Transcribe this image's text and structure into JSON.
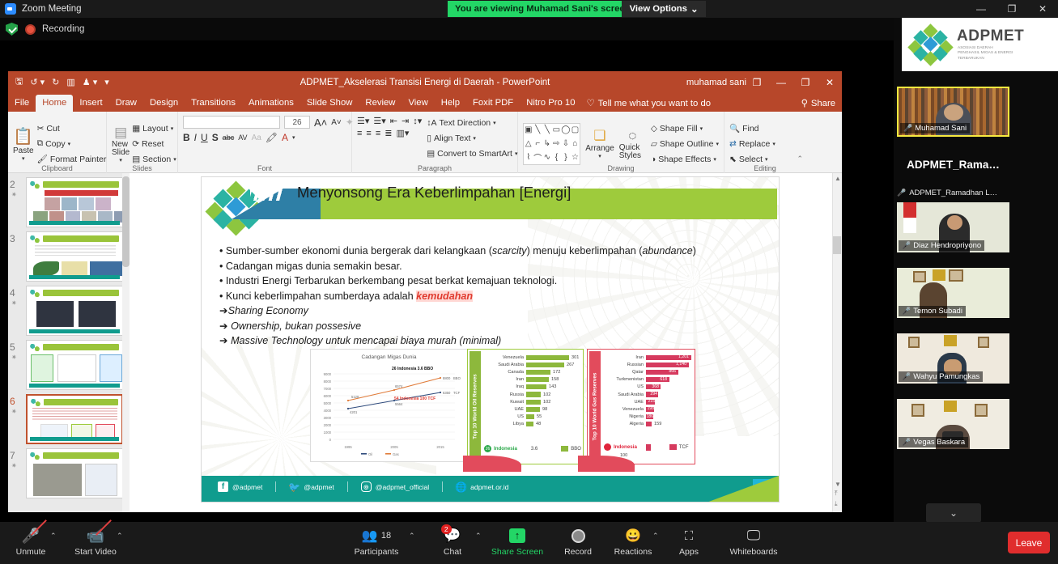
{
  "zoom": {
    "window_title": "Zoom Meeting",
    "viewing_banner": "You are viewing Muhamad Sani's screen",
    "view_options": "View Options",
    "view_options_caret": "⌄",
    "recording_label": "Recording",
    "win_min": "—",
    "win_max": "❐",
    "win_close": "✕"
  },
  "powerpoint": {
    "document_title": "ADPMET_Akselerasi Transisi Energi di Daerah",
    "app_name": "PowerPoint",
    "title_separator": "-",
    "user": "muhamad sani",
    "qat": [
      "save-icon",
      "undo-icon",
      "redo-icon",
      "present-icon",
      "account-icon",
      "more-icon"
    ],
    "win_restore": "❐",
    "win_min": "—",
    "win_max": "❐",
    "win_close": "✕",
    "tabs": [
      "File",
      "Home",
      "Insert",
      "Draw",
      "Design",
      "Transitions",
      "Animations",
      "Slide Show",
      "Review",
      "View",
      "Help",
      "Foxit PDF",
      "Nitro Pro 10"
    ],
    "active_tab": "Home",
    "tell_me": "Tell me what you want to do",
    "share": "Share",
    "groups": {
      "clipboard": {
        "label": "Clipboard",
        "paste": "Paste",
        "cut": "Cut",
        "copy": "Copy",
        "format_painter": "Format Painter"
      },
      "slides": {
        "label": "Slides",
        "new_slide": "New Slide",
        "layout": "Layout",
        "reset": "Reset",
        "section": "Section"
      },
      "font": {
        "label": "Font",
        "font_name": "",
        "font_size": "26",
        "grow": "A",
        "shrink": "A",
        "bold": "B",
        "italic": "I",
        "underline": "U",
        "shadow": "S",
        "strike": "abc",
        "spacing": "AV",
        "case": "Aa",
        "highlight": "A",
        "color": "A"
      },
      "paragraph": {
        "label": "Paragraph",
        "text_direction": "Text Direction",
        "align_text": "Align Text",
        "convert_smartart": "Convert to SmartArt"
      },
      "drawing": {
        "label": "Drawing",
        "arrange": "Arrange",
        "quick_styles": "Quick Styles",
        "shape_fill": "Shape Fill",
        "shape_outline": "Shape Outline",
        "shape_effects": "Shape Effects"
      },
      "editing": {
        "label": "Editing",
        "find": "Find",
        "replace": "Replace",
        "select": "Select"
      }
    },
    "thumbnails": [
      {
        "number": "2",
        "starred": true,
        "selected": false
      },
      {
        "number": "3",
        "starred": false,
        "selected": false
      },
      {
        "number": "4",
        "starred": true,
        "selected": false
      },
      {
        "number": "5",
        "starred": true,
        "selected": false
      },
      {
        "number": "6",
        "starred": true,
        "selected": true
      },
      {
        "number": "7",
        "starred": true,
        "selected": false
      }
    ]
  },
  "slide": {
    "title": "Menyonsong Era Keberlimpahan [Energi]",
    "bullets": [
      {
        "marker": "•",
        "text": "Sumber-sumber ekonomi dunia bergerak dari kelangkaan (scarcity) menuju keberlimpahan (abundance)"
      },
      {
        "marker": "•",
        "text": "Cadangan migas dunia semakin besar."
      },
      {
        "marker": "•",
        "text": "Industri Energi Terbarukan berkembang pesat berkat kemajuan teknologi."
      },
      {
        "marker": "•",
        "text": "Kunci keberlimpahan sumberdaya adalah kemudahan",
        "highlight": "kemudahan"
      },
      {
        "marker": "➔",
        "text": "Sharing Economy"
      },
      {
        "marker": "➔",
        "text": "Ownership, bukan possesive"
      },
      {
        "marker": "➔",
        "text": "Massive Technology untuk mencapai biaya murah (minimal)"
      }
    ],
    "footer": {
      "facebook": "@adpmet",
      "twitter": "@adpmet",
      "instagram": "@adpmet_official",
      "website": "adpmet.or.id",
      "page_badge": "(#)"
    }
  },
  "chart_data": [
    {
      "type": "line",
      "title": "Cadangan Migas Dunia",
      "x": [
        "1995",
        "2005",
        "2015"
      ],
      "xlabel": "",
      "ylabel": "",
      "ylim": [
        0,
        9000
      ],
      "yticks": [
        "0",
        "1000",
        "2000",
        "3000",
        "4000",
        "5000",
        "6000",
        "7000",
        "8000",
        "9000"
      ],
      "grid": true,
      "legend": [
        "Oil",
        "Gas"
      ],
      "legend_position": "bottom",
      "series": [
        {
          "name": "Oil",
          "color": "#2f4b7c",
          "values": [
            4201,
            5564,
            6350
          ],
          "point_labels": [
            "4201",
            "5564",
            "6350"
          ],
          "end_label": "TCF"
        },
        {
          "name": "Gas",
          "color": "#e07b39",
          "values": [
            5128,
            6574,
            8800
          ],
          "point_labels": [
            "5128",
            "6574",
            "8800"
          ],
          "end_label": "BBO"
        }
      ],
      "annotations": [
        {
          "text": "26 Indonesia 3.6 BBO",
          "color": "#111111"
        },
        {
          "text": "54 Indonesia 100 TCF",
          "color": "#e03b2f"
        }
      ]
    },
    {
      "type": "bar",
      "title": "Top 10 World Oil Reserves",
      "orientation": "horizontal",
      "unit": "BBO",
      "categories": [
        "Venezuela",
        "Saudi Arabia",
        "Canada",
        "Iran",
        "Iraq",
        "Russia",
        "Kuwait",
        "UAE",
        "US",
        "Libya"
      ],
      "values": [
        301,
        267,
        172,
        158,
        143,
        102,
        102,
        98,
        55,
        48
      ],
      "bar_color": "#8db83c",
      "highlight_row": {
        "label": "Indonesia",
        "value": "3.6",
        "color": "#2ba84a"
      },
      "legend": [
        "BBO"
      ]
    },
    {
      "type": "bar",
      "title": "Top 10 World Gas Reserves",
      "orientation": "horizontal",
      "unit": "TCF",
      "categories": [
        "Iran",
        "Russian",
        "Qatar",
        "Turkmenistan",
        "US",
        "Saudi Arabia",
        "UAE",
        "Venezuela",
        "Nigeria",
        "Algeria"
      ],
      "values": [
        1201,
        1140,
        866,
        618,
        368,
        294,
        215,
        198,
        186,
        159
      ],
      "value_labels": [
        "1,201",
        "1,140",
        "866",
        "618",
        "368",
        "294",
        "215",
        "198",
        "186",
        "159"
      ],
      "bar_color": "#d63a5e",
      "highlight_row": {
        "label": "Indonesia",
        "value": "100",
        "color": "#e0253c"
      },
      "legend": [
        "TCF"
      ]
    }
  ],
  "video_panel": {
    "brand": {
      "name": "ADPMET",
      "tagline": "ASOSIASI DAERAH\nPENGHASIL MIGAS & ENERGI\nTERBARUKAN"
    },
    "participants": [
      {
        "name": "Muhamad Sani",
        "muted": true,
        "active": true,
        "type": "video"
      },
      {
        "name": "ADPMET_Rama…",
        "type": "name-card"
      },
      {
        "name": "ADPMET_Ramadhan L…",
        "muted": true,
        "type": "label"
      },
      {
        "name": "Diaz Hendropriyono",
        "muted": true,
        "type": "video"
      },
      {
        "name": "Temon Subadi",
        "muted": true,
        "type": "video"
      },
      {
        "name": "Wahyu Pamungkas",
        "muted": true,
        "type": "video"
      },
      {
        "name": "Vegas Baskara",
        "muted": true,
        "type": "video"
      }
    ],
    "scroll_down": "⌄"
  },
  "toolbar": {
    "items": [
      {
        "label": "Unmute",
        "icon": "mic-off-icon",
        "caret": true
      },
      {
        "label": "Start Video",
        "icon": "video-off-icon",
        "caret": true
      },
      {
        "label": "Participants",
        "icon": "participants-icon",
        "caret": true,
        "count": "18"
      },
      {
        "label": "Chat",
        "icon": "chat-icon",
        "caret": true,
        "badge": "2"
      },
      {
        "label": "Share Screen",
        "icon": "share-screen-icon",
        "highlight": true
      },
      {
        "label": "Record",
        "icon": "record-icon"
      },
      {
        "label": "Reactions",
        "icon": "reactions-icon",
        "caret": true
      },
      {
        "label": "Apps",
        "icon": "apps-icon"
      },
      {
        "label": "Whiteboards",
        "icon": "whiteboard-icon"
      }
    ],
    "leave": "Leave"
  }
}
